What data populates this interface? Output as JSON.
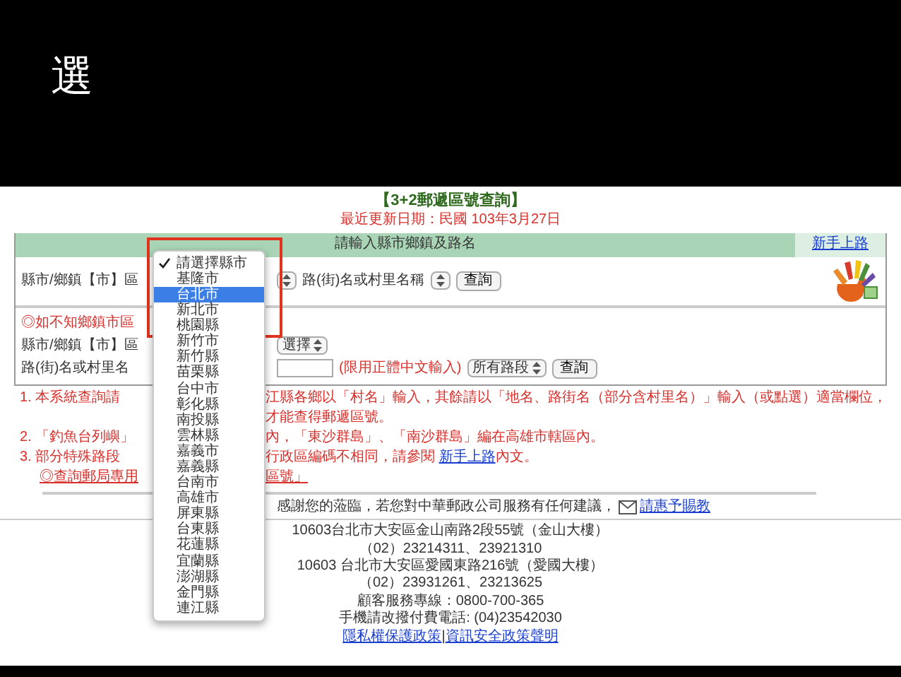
{
  "slide_title": "選",
  "page": {
    "title": "【3+2郵遞區號查詢】",
    "updated": "最近更新日期：民國 103年3月27日",
    "panel": {
      "header": "請輸入縣市鄉鎮及路名",
      "help_link": "新手上路"
    },
    "row_1": {
      "label": "縣市/鄉鎮【市】區",
      "street_label": "路(街)名或村里名稱",
      "button": "查詢"
    },
    "hint": "◎如不知鄉鎮市區",
    "row_2": {
      "label": "縣市/鄉鎮【市】區",
      "select_text": "選擇"
    },
    "row_3": {
      "label": "路(街)名或村里名",
      "input_hint": "(限用正體中文輸入)",
      "select_text": "所有路段",
      "button": "查詢"
    },
    "notes": [
      {
        "before": "1. 本系統查詢請",
        "after": "江縣各鄉以「村名」輸入，其餘請以「地名、路街名（部分含村里名）」輸入（或點選）適當欄位，才能查得郵遞區號。"
      },
      {
        "before": "2. 「釣魚台列嶼」",
        "after": "內，「東沙群島」、「南沙群島」編在高雄市轄區內。"
      },
      {
        "before": "3. 部分特殊路段",
        "after": "行政區編碼不相同，請參閱 ",
        "link": "新手上路",
        "tail": "內文。"
      }
    ],
    "special_link": {
      "before": "◎查詢郵局專用",
      "after": "區號」"
    },
    "thanks": {
      "text": "感謝您的蒞臨，若您對中華郵政公司服務有任何建議，",
      "link": "請惠予賜教"
    },
    "address_lines": [
      "10603台北市大安區金山南路2段55號（金山大樓）",
      "（02）23214311、23921310",
      "10603 台北市大安區愛國東路216號（愛國大樓）",
      "（02）23931261、23213625",
      "顧客服務專線：0800-700-365",
      "手機請改撥付費電話: (04)23542030"
    ],
    "footer_links": [
      "隱私權保護政策",
      "資訊安全政策聲明"
    ],
    "footer_separator": "|"
  },
  "dropdown": [
    {
      "label": "請選擇縣市",
      "checked": true,
      "selected": false
    },
    {
      "label": "基隆市",
      "checked": false,
      "selected": false
    },
    {
      "label": "台北市",
      "checked": false,
      "selected": true
    },
    {
      "label": "新北市",
      "checked": false,
      "selected": false
    },
    {
      "label": "桃園縣",
      "checked": false,
      "selected": false
    },
    {
      "label": "新竹市",
      "checked": false,
      "selected": false
    },
    {
      "label": "新竹縣",
      "checked": false,
      "selected": false
    },
    {
      "label": "苗栗縣",
      "checked": false,
      "selected": false
    },
    {
      "label": "台中市",
      "checked": false,
      "selected": false
    },
    {
      "label": "彰化縣",
      "checked": false,
      "selected": false
    },
    {
      "label": "南投縣",
      "checked": false,
      "selected": false
    },
    {
      "label": "雲林縣",
      "checked": false,
      "selected": false
    },
    {
      "label": "嘉義市",
      "checked": false,
      "selected": false
    },
    {
      "label": "嘉義縣",
      "checked": false,
      "selected": false
    },
    {
      "label": "台南市",
      "checked": false,
      "selected": false
    },
    {
      "label": "高雄市",
      "checked": false,
      "selected": false
    },
    {
      "label": "屏東縣",
      "checked": false,
      "selected": false
    },
    {
      "label": "台東縣",
      "checked": false,
      "selected": false
    },
    {
      "label": "花蓮縣",
      "checked": false,
      "selected": false
    },
    {
      "label": "宜蘭縣",
      "checked": false,
      "selected": false
    },
    {
      "label": "澎湖縣",
      "checked": false,
      "selected": false
    },
    {
      "label": "金門縣",
      "checked": false,
      "selected": false
    },
    {
      "label": "連江縣",
      "checked": false,
      "selected": false
    }
  ]
}
